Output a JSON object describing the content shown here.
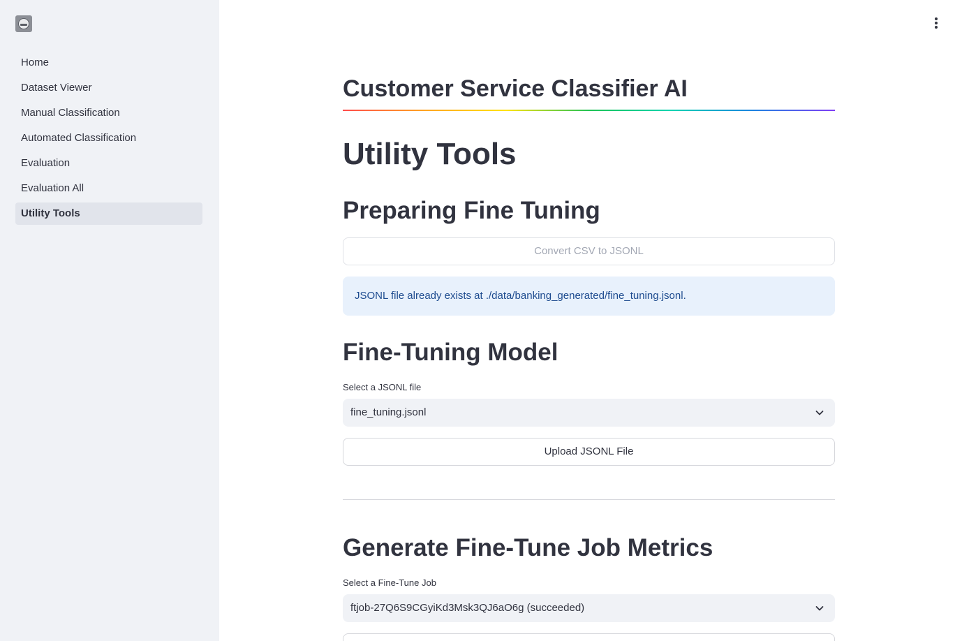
{
  "sidebar": {
    "items": [
      {
        "label": "Home"
      },
      {
        "label": "Dataset Viewer"
      },
      {
        "label": "Manual Classification"
      },
      {
        "label": "Automated Classification"
      },
      {
        "label": "Evaluation"
      },
      {
        "label": "Evaluation All"
      },
      {
        "label": "Utility Tools",
        "active": true
      }
    ]
  },
  "header": {
    "app_title": "Customer Service Classifier AI",
    "menu_icon": "vertical-ellipsis-icon"
  },
  "main": {
    "page_title": "Utility Tools",
    "sections": {
      "preparing": {
        "heading": "Preparing Fine Tuning",
        "convert_button": "Convert CSV to JSONL",
        "info_message": "JSONL file already exists at ./data/banking_generated/fine_tuning.jsonl."
      },
      "fine_tuning": {
        "heading": "Fine-Tuning Model",
        "select_label": "Select a JSONL file",
        "select_value": "fine_tuning.jsonl",
        "upload_button": "Upload JSONL File"
      },
      "metrics": {
        "heading": "Generate Fine-Tune Job Metrics",
        "select_label": "Select a Fine-Tune Job",
        "select_value": "ftjob-27Q6S9CGyiKd3Msk3QJ6aO6g (succeeded)"
      }
    }
  },
  "colors": {
    "sidebar_bg": "#f0f2f6",
    "active_nav_bg": "#e1e4eb",
    "info_bg": "#e8f1fc",
    "info_text": "#1d4b8f",
    "text": "#31333f"
  }
}
